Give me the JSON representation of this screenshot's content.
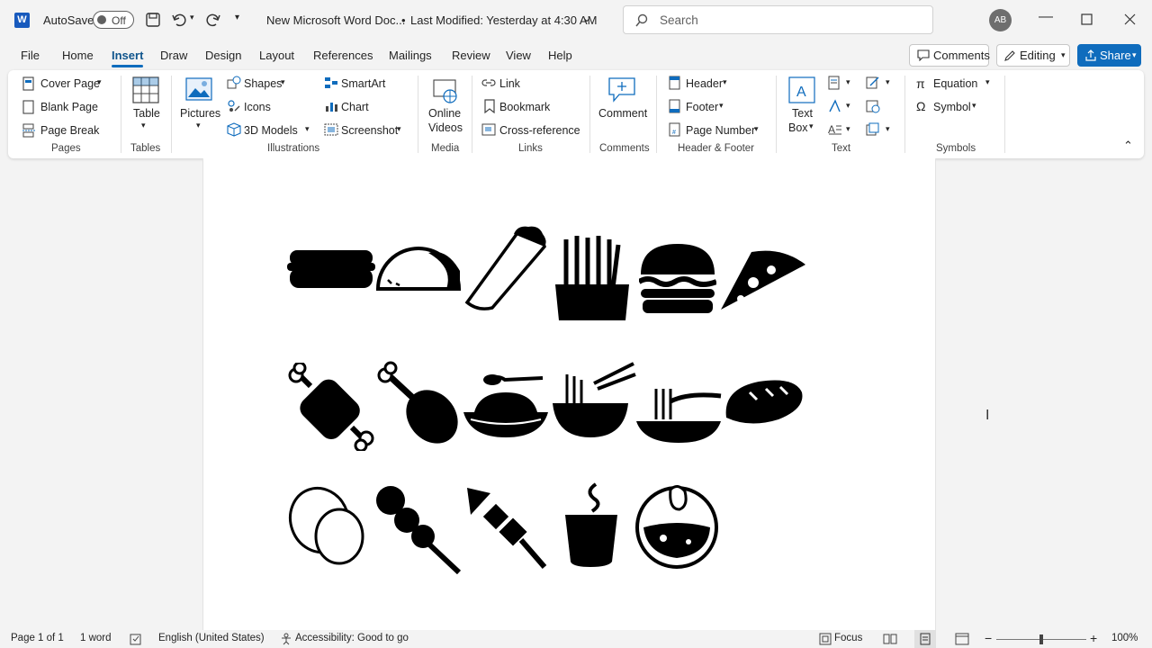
{
  "titlebar": {
    "autosave_label": "AutoSave",
    "autosave_state": "Off",
    "doc_title": "New Microsoft Word Doc...",
    "last_modified": "Last Modified: Yesterday at 4:30 AM",
    "search_placeholder": "Search",
    "avatar_initials": "AB"
  },
  "tabs": [
    "File",
    "Home",
    "Insert",
    "Draw",
    "Design",
    "Layout",
    "References",
    "Mailings",
    "Review",
    "View",
    "Help"
  ],
  "actions": {
    "comments": "Comments",
    "editing": "Editing",
    "share": "Share"
  },
  "ribbon": {
    "pages": {
      "cover": "Cover Page",
      "blank": "Blank Page",
      "break": "Page Break",
      "group": "Pages"
    },
    "tables": {
      "table": "Table",
      "group": "Tables"
    },
    "illustrations": {
      "pictures": "Pictures",
      "shapes": "Shapes",
      "icons": "Icons",
      "models": "3D Models",
      "smartart": "SmartArt",
      "chart": "Chart",
      "screenshot": "Screenshot",
      "group": "Illustrations"
    },
    "media": {
      "online_videos_1": "Online",
      "online_videos_2": "Videos",
      "group": "Media"
    },
    "links": {
      "link": "Link",
      "bookmark": "Bookmark",
      "crossref": "Cross-reference",
      "group": "Links"
    },
    "comments": {
      "comment": "Comment",
      "group": "Comments"
    },
    "header_footer": {
      "header": "Header",
      "footer": "Footer",
      "page_number": "Page Number",
      "group": "Header & Footer"
    },
    "text": {
      "textbox_1": "Text",
      "textbox_2": "Box",
      "group": "Text"
    },
    "symbols": {
      "equation": "Equation",
      "symbol": "Symbol",
      "group": "Symbols"
    }
  },
  "document": {
    "icons_row1": [
      "hotdog-icon",
      "taco-icon",
      "burrito-icon",
      "fries-icon",
      "burger-icon",
      "pizza-slice-icon"
    ],
    "icons_row2": [
      "meat-bone-icon",
      "chicken-leg-icon",
      "rice-bowl-icon",
      "noodle-bowl-icon",
      "spaghetti-icon",
      "bread-icon"
    ],
    "icons_row3": [
      "eggs-icon",
      "dango-icon",
      "skewer-icon",
      "coffee-cup-icon",
      "curry-bowl-icon"
    ]
  },
  "statusbar": {
    "page": "Page 1 of 1",
    "words": "1 word",
    "language": "English (United States)",
    "accessibility": "Accessibility: Good to go",
    "focus": "Focus",
    "zoom": "100%"
  },
  "colors": {
    "accent": "#0f6cbd",
    "tab_active": "#0f548c",
    "word_blue": "#185abd"
  }
}
